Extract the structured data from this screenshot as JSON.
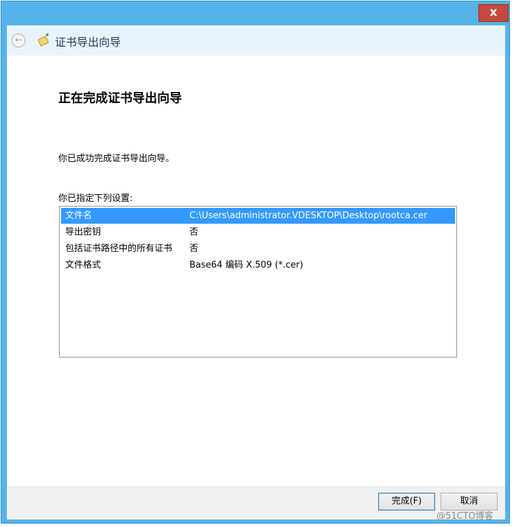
{
  "window": {
    "close_label": "x",
    "title": "证书导出向导"
  },
  "page": {
    "heading": "正在完成证书导出向导",
    "success_text": "你已成功完成证书导出向导。",
    "settings_label": "你已指定下列设置:"
  },
  "settings": [
    {
      "key": "文件名",
      "value": "C:\\Users\\administrator.VDESKTOP\\Desktop\\rootca.cer",
      "selected": true
    },
    {
      "key": "导出密钥",
      "value": "否",
      "selected": false
    },
    {
      "key": "包括证书路径中的所有证书",
      "value": "否",
      "selected": false
    },
    {
      "key": "文件格式",
      "value": "Base64 编码 X.509 (*.cer)",
      "selected": false
    }
  ],
  "buttons": {
    "finish": "完成(F)",
    "cancel": "取消"
  },
  "watermark": "@51CTO博客",
  "colors": {
    "titlebar": "#54b4ea",
    "close": "#c7483c",
    "selection": "#3399ff"
  },
  "icons": {
    "back": "back-arrow-icon",
    "wizard": "certificate-wizard-icon"
  }
}
